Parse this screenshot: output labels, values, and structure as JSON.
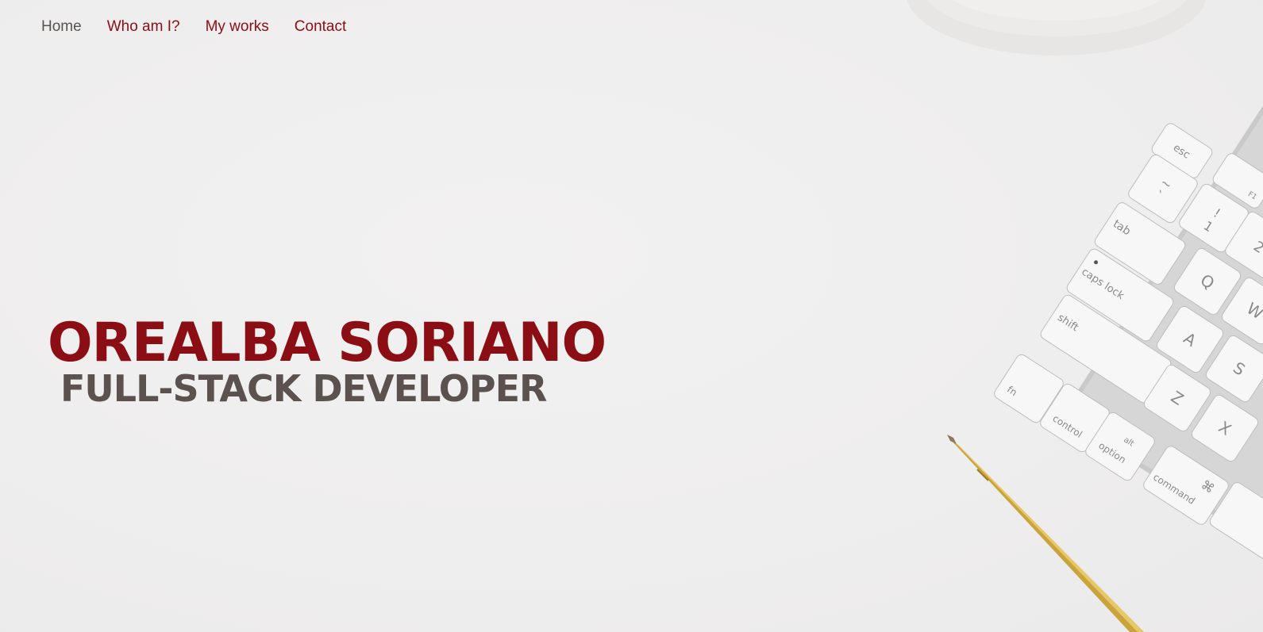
{
  "nav": {
    "items": [
      {
        "label": "Home"
      },
      {
        "label": "Who am I?"
      },
      {
        "label": "My works"
      },
      {
        "label": "Contact"
      }
    ]
  },
  "hero": {
    "name": "OREALBA SORIANO",
    "role": "FULL-STACK DEVELOPER"
  },
  "keyboard": {
    "keys": {
      "esc": "esc",
      "tilde": "~",
      "backtick": "`",
      "excl": "!",
      "one": "1",
      "two": "2",
      "tab": "tab",
      "q": "Q",
      "w": "W",
      "caps": "caps lock",
      "a": "A",
      "s": "S",
      "shift": "shift",
      "z": "Z",
      "x": "X",
      "fn": "fn",
      "control": "control",
      "alt": "alt",
      "option": "option",
      "cmd_symbol": "⌘",
      "command": "command",
      "f1": "F1"
    }
  },
  "colors": {
    "accent": "#8b0e14",
    "muted": "#5b524f",
    "background": "#efeeee"
  }
}
